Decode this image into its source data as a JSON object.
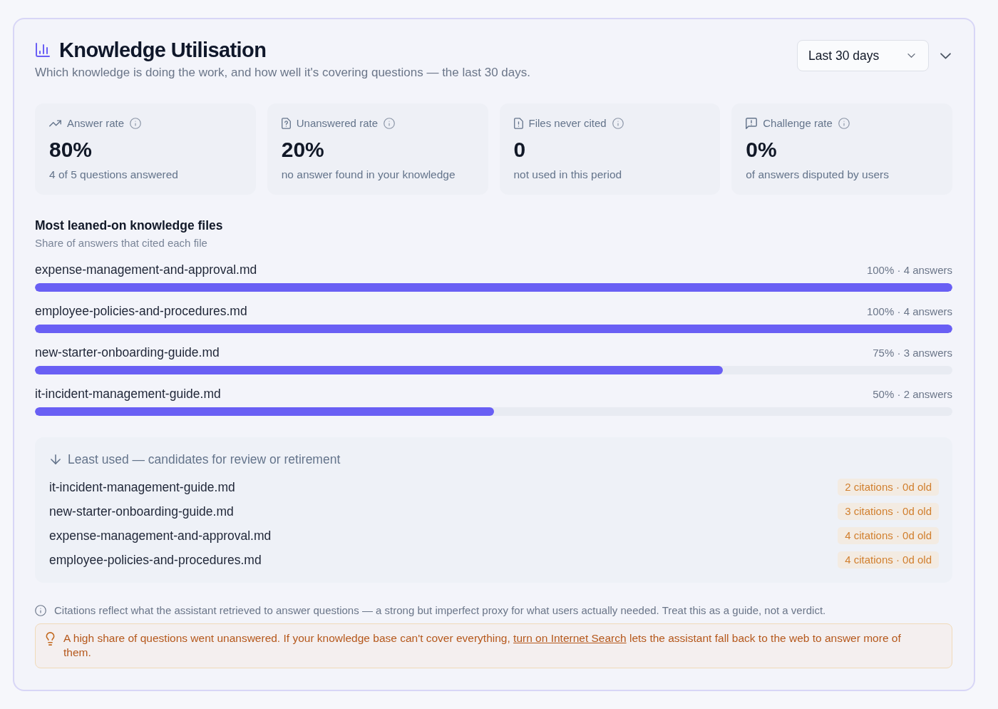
{
  "header": {
    "title": "Knowledge Utilisation",
    "subtitle": "Which knowledge is doing the work, and how well it's covering questions — the last 30 days.",
    "period": "Last 30 days"
  },
  "stats": [
    {
      "label": "Answer rate",
      "value": "80%",
      "caption": "4 of 5 questions answered"
    },
    {
      "label": "Unanswered rate",
      "value": "20%",
      "caption": "no answer found in your knowledge"
    },
    {
      "label": "Files never cited",
      "value": "0",
      "caption": "not used in this period"
    },
    {
      "label": "Challenge rate",
      "value": "0%",
      "caption": "of answers disputed by users"
    }
  ],
  "top_files": {
    "title": "Most leaned-on knowledge files",
    "subtitle": "Share of answers that cited each file",
    "items": [
      {
        "name": "expense-management-and-approval.md",
        "reading": "100% · 4 answers",
        "level": 1
      },
      {
        "name": "employee-policies-and-procedures.md",
        "reading": "100% · 4 answers",
        "level": 1
      },
      {
        "name": "new-starter-onboarding-guide.md",
        "reading": "75% · 3 answers",
        "level": 0.75
      },
      {
        "name": "it-incident-management-guide.md",
        "reading": "50% · 2 answers",
        "level": 0.5
      }
    ]
  },
  "least_used": {
    "title": "Least used — candidates for review or retirement",
    "items": [
      {
        "name": "it-incident-management-guide.md",
        "tag": "2 citations · 0d old"
      },
      {
        "name": "new-starter-onboarding-guide.md",
        "tag": "3 citations · 0d old"
      },
      {
        "name": "expense-management-and-approval.md",
        "tag": "4 citations · 0d old"
      },
      {
        "name": "employee-policies-and-procedures.md",
        "tag": "4 citations · 0d old"
      }
    ]
  },
  "note": "Citations reflect what the assistant retrieved to answer questions — a strong but imperfect proxy for what users actually needed. Treat this as a guide, not a verdict.",
  "alert": {
    "text_before": "A high share of questions went unanswered. If your knowledge base can't cover everything,",
    "link": "turn on Internet Search",
    "text_after": "lets the assistant fall back to the web to answer more of them."
  }
}
